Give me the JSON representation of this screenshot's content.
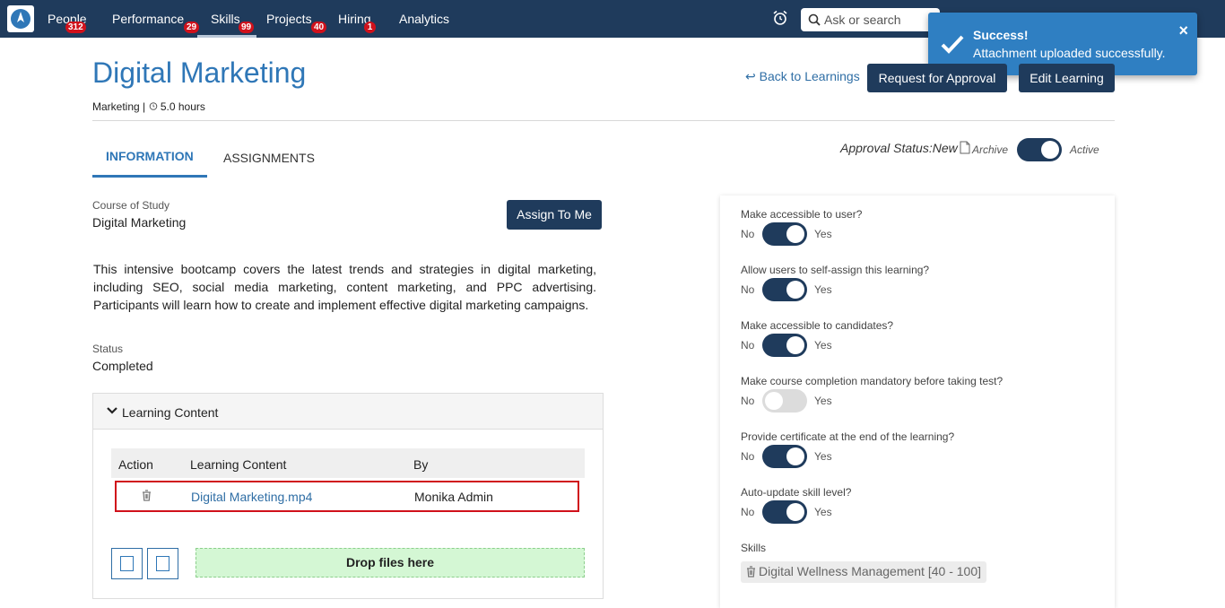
{
  "nav": {
    "items": [
      {
        "label": "People",
        "badge": "312"
      },
      {
        "label": "Performance",
        "badge": "29"
      },
      {
        "label": "Skills",
        "badge": "99"
      },
      {
        "label": "Projects",
        "badge": "40"
      },
      {
        "label": "Hiring",
        "badge": "1"
      },
      {
        "label": "Analytics",
        "badge": ""
      }
    ],
    "search_placeholder": "Ask or search"
  },
  "toast": {
    "title": "Success!",
    "message": "Attachment uploaded successfully."
  },
  "header": {
    "title": "Digital Marketing",
    "category": "Marketing",
    "separator": "|",
    "duration": "5.0 hours",
    "back_label": "Back to Learnings",
    "request_approval_label": "Request for Approval",
    "edit_label": "Edit Learning"
  },
  "tabs": [
    {
      "label": "INFORMATION",
      "active": true
    },
    {
      "label": "ASSIGNMENTS",
      "active": false
    }
  ],
  "approval": {
    "status_text": "Approval Status:New",
    "archive_label": "Archive",
    "active_label": "Active",
    "active": true
  },
  "info": {
    "course_label": "Course of Study",
    "course_value": "Digital Marketing",
    "assign_label": "Assign To Me",
    "description": "This intensive bootcamp covers the latest trends and strategies in digital marketing, including SEO, social media marketing, content marketing, and PPC advertising. Participants will learn how to create and implement effective digital marketing campaigns.",
    "status_label": "Status",
    "status_value": "Completed"
  },
  "learning_content": {
    "title": "Learning Content",
    "columns": [
      "Action",
      "Learning Content",
      "By"
    ],
    "rows": [
      {
        "file": "Digital Marketing.mp4",
        "by": "Monika Admin"
      }
    ],
    "dropzone_label": "Drop files here"
  },
  "settings": {
    "no_label": "No",
    "yes_label": "Yes",
    "options": [
      {
        "label": "Make accessible to user?",
        "value": true
      },
      {
        "label": "Allow users to self-assign this learning?",
        "value": true
      },
      {
        "label": "Make accessible to candidates?",
        "value": true
      },
      {
        "label": "Make course completion mandatory before taking test?",
        "value": false
      },
      {
        "label": "Provide certificate at the end of the learning?",
        "value": true
      },
      {
        "label": "Auto-update skill level?",
        "value": true
      }
    ],
    "skills_label": "Skills",
    "skills": [
      {
        "name": "Digital Wellness Management",
        "range": "[40 - 100]"
      }
    ]
  },
  "colors": {
    "nav_bg": "#1f3b5c",
    "accent": "#2f77b7",
    "toast_bg": "#2f7fc2",
    "badge": "#d0111b",
    "dropzone": "#d4f7d4"
  }
}
